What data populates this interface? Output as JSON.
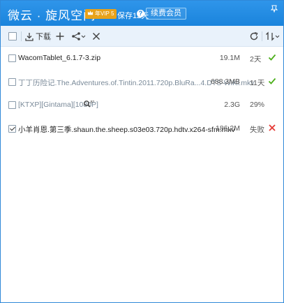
{
  "titlebar": {
    "app_title": "微云 · 旋风空间",
    "vip_badge": "年VIP 5",
    "retain_text": "保存12天",
    "help_icon": "?",
    "renew_label": "续费会员"
  },
  "toolbar": {
    "download_label": "下载"
  },
  "files": [
    {
      "name": "WacomTablet_6.1.7-3.zip",
      "size": "19.1M",
      "status": "2天",
      "status_icon": "check-icon",
      "checked": false,
      "muted": false
    },
    {
      "name": "丁丁历险记.The.Adventures.of.Tintin.2011.720p.BluRa...4.DTS-WiKi.mkv",
      "size": "688.3MB",
      "status": "11天",
      "status_icon": "check-icon",
      "checked": false,
      "muted": true
    },
    {
      "name": "[KTXP][Gintama][1080P]",
      "size": "2.3G",
      "status": "29%",
      "status_icon": "",
      "checked": false,
      "muted": true
    },
    {
      "name": "小羊肖恩.第三季.shaun.the.sheep.s03e03.720p.hdtv.x264-sfm.mkv",
      "size": "186.2M",
      "status": "失败",
      "status_icon": "cross-icon",
      "checked": true,
      "muted": false
    }
  ],
  "colors": {
    "titlebar": "#1a84dc",
    "success": "#4caf1a",
    "error": "#e53935",
    "vip": "#e8a21a"
  }
}
